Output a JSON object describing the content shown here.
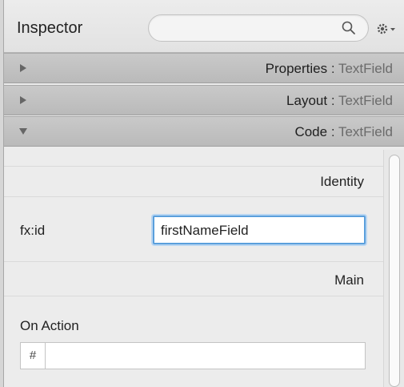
{
  "header": {
    "title": "Inspector",
    "search_placeholder": ""
  },
  "icons": {
    "search": "search-icon",
    "gear": "gear-icon",
    "collapsed": "triangle-right-icon",
    "expanded": "triangle-down-icon"
  },
  "sections": [
    {
      "name": "Properties",
      "separator": " : ",
      "type": "TextField",
      "expanded": false
    },
    {
      "name": "Layout",
      "separator": " : ",
      "type": "TextField",
      "expanded": false
    },
    {
      "name": "Code",
      "separator": " : ",
      "type": "TextField",
      "expanded": true
    }
  ],
  "code": {
    "identity_heading": "Identity",
    "fxid_label": "fx:id",
    "fxid_value": "firstNameField",
    "main_heading": "Main",
    "on_action_label": "On Action",
    "on_action_prefix": "#",
    "on_action_value": ""
  },
  "colors": {
    "focus_ring": "#5a9fdc",
    "section_bg": "#c2c2c2",
    "panel_bg": "#ececec"
  }
}
